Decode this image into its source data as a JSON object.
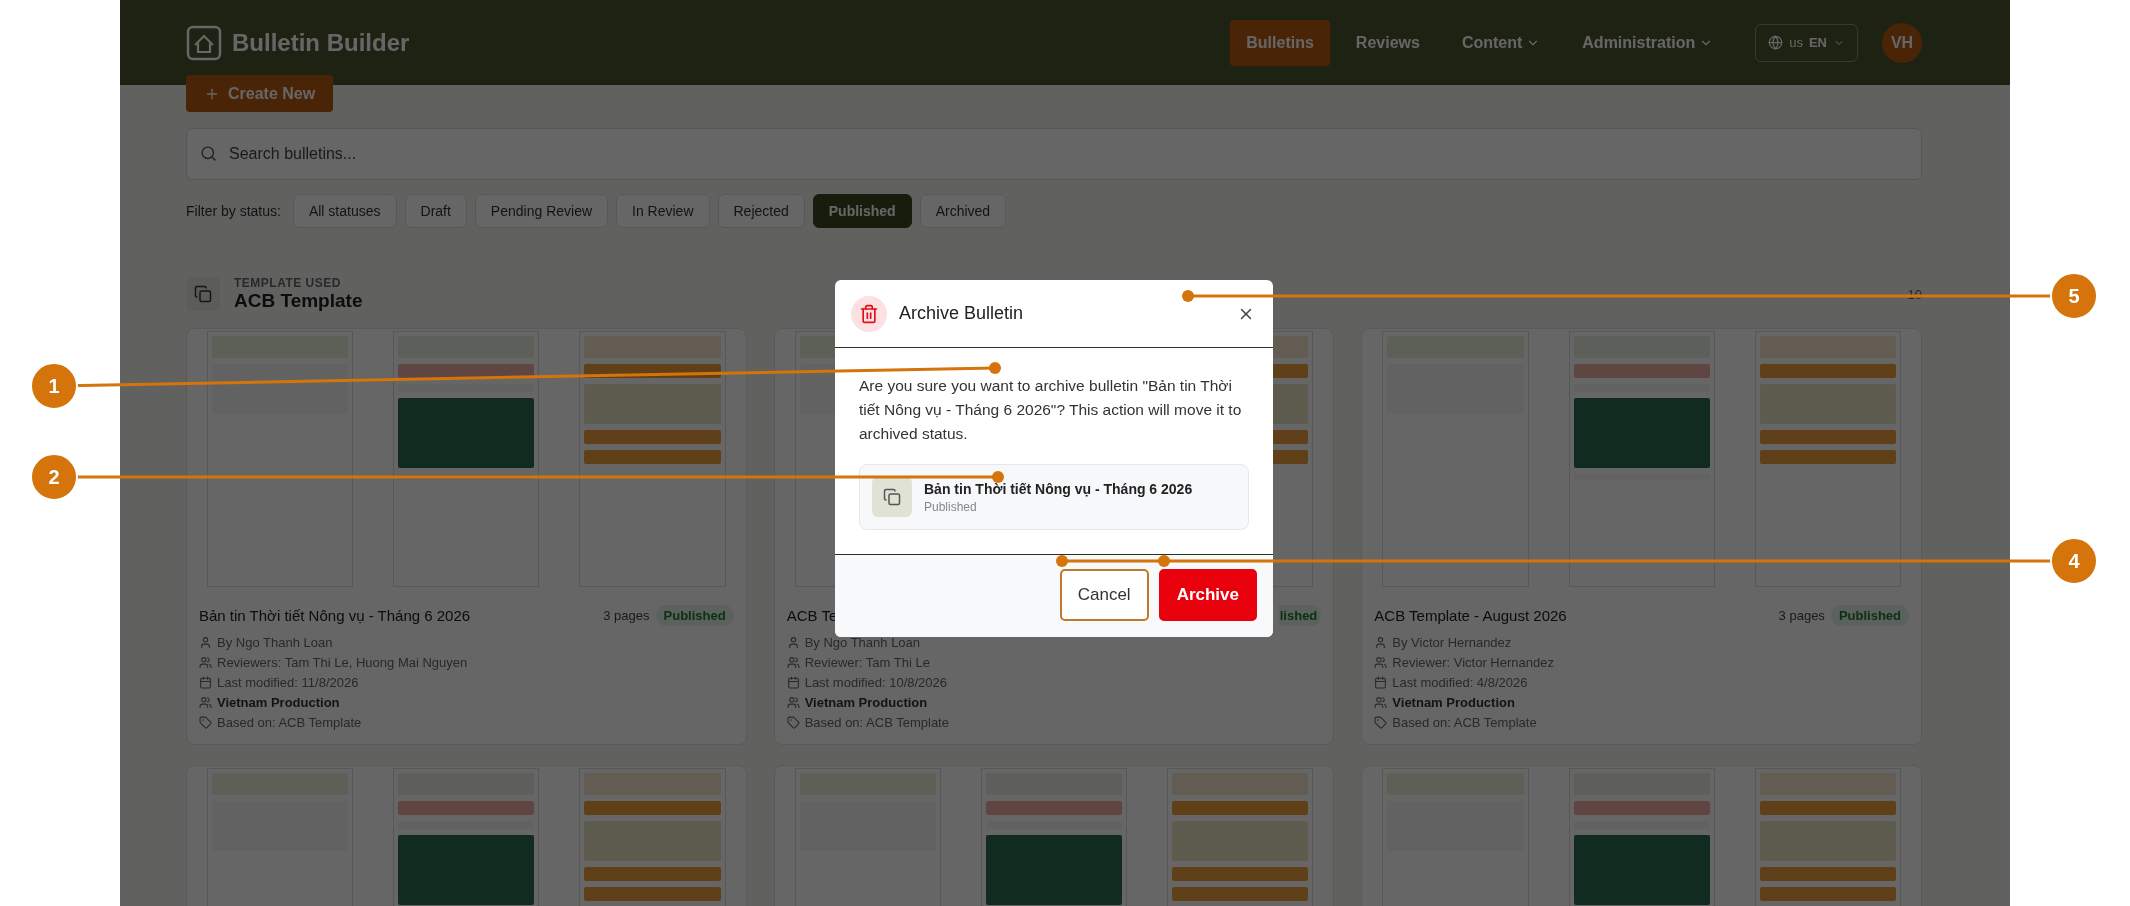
{
  "app": {
    "title": "Bulletin Builder"
  },
  "nav": [
    {
      "label": "Bulletins",
      "selected": true,
      "kind": "link"
    },
    {
      "label": "Reviews",
      "selected": false,
      "kind": "link"
    },
    {
      "label": "Content",
      "selected": false,
      "kind": "menu"
    },
    {
      "label": "Administration",
      "selected": false,
      "kind": "menu"
    }
  ],
  "language": {
    "flag": "us",
    "code": "EN"
  },
  "user": {
    "initials": "VH"
  },
  "create_button": "Create New",
  "search": {
    "placeholder": "Search bulletins..."
  },
  "filter": {
    "label": "Filter by status:",
    "options": [
      {
        "label": "All statuses",
        "selected": false
      },
      {
        "label": "Draft",
        "selected": false
      },
      {
        "label": "Pending Review",
        "selected": false
      },
      {
        "label": "In Review",
        "selected": false
      },
      {
        "label": "Rejected",
        "selected": false
      },
      {
        "label": "Published",
        "selected": true
      },
      {
        "label": "Archived",
        "selected": false
      }
    ]
  },
  "group": {
    "caption": "TEMPLATE USED",
    "title": "ACB Template",
    "count": "10"
  },
  "bulletins": [
    {
      "kind": "full",
      "title": "Bản tin Thời tiết Nông vụ - Tháng 6 2026",
      "pages": "3 pages",
      "status": "Published",
      "meta": [
        {
          "kind": "author",
          "text": "By Ngo Thanh Loan"
        },
        {
          "kind": "reviewers",
          "text": "Reviewers: Tam Thi Le, Huong Mai Nguyen"
        },
        {
          "kind": "modified",
          "text": "Last modified: 11/8/2026"
        },
        {
          "kind": "team",
          "text": "Vietnam Production"
        },
        {
          "kind": "template",
          "text": "Based on: ACB Template"
        }
      ]
    },
    {
      "kind": "full",
      "title": "ACB Te",
      "status": "lished",
      "meta": [
        {
          "kind": "author",
          "text": "By Ngo Thanh Loan"
        },
        {
          "kind": "reviewers",
          "text": "Reviewer: Tam Thi Le"
        },
        {
          "kind": "modified",
          "text": "Last modified: 10/8/2026"
        },
        {
          "kind": "team",
          "text": "Vietnam Production"
        },
        {
          "kind": "template",
          "text": "Based on: ACB Template"
        }
      ]
    },
    {
      "kind": "full",
      "title": "ACB Template - August 2026",
      "pages": "3 pages",
      "status": "Published",
      "meta": [
        {
          "kind": "author",
          "text": "By Victor Hernandez"
        },
        {
          "kind": "reviewers",
          "text": "Reviewer: Victor Hernandez"
        },
        {
          "kind": "modified",
          "text": "Last modified: 4/8/2026"
        },
        {
          "kind": "team",
          "text": "Vietnam Production"
        },
        {
          "kind": "template",
          "text": "Based on: ACB Template"
        }
      ]
    },
    {
      "kind": "preview"
    },
    {
      "kind": "preview"
    },
    {
      "kind": "preview"
    }
  ],
  "dialog": {
    "title": "Archive Bulletin",
    "message": "Are you sure you want to archive bulletin \"Bản tin Thời tiết Nông vụ - Tháng 6 2026\"? This action will move it to archived status.",
    "item": {
      "title": "Bản tin Thời tiết Nông vụ - Tháng 6 2026",
      "status": "Published"
    },
    "buttons": [
      {
        "label": "Cancel",
        "kind": "secondary"
      },
      {
        "label": "Archive",
        "kind": "danger"
      }
    ]
  },
  "callouts": [
    {
      "number": "1"
    },
    {
      "number": "2"
    },
    {
      "number": "4"
    },
    {
      "number": "5"
    }
  ]
}
